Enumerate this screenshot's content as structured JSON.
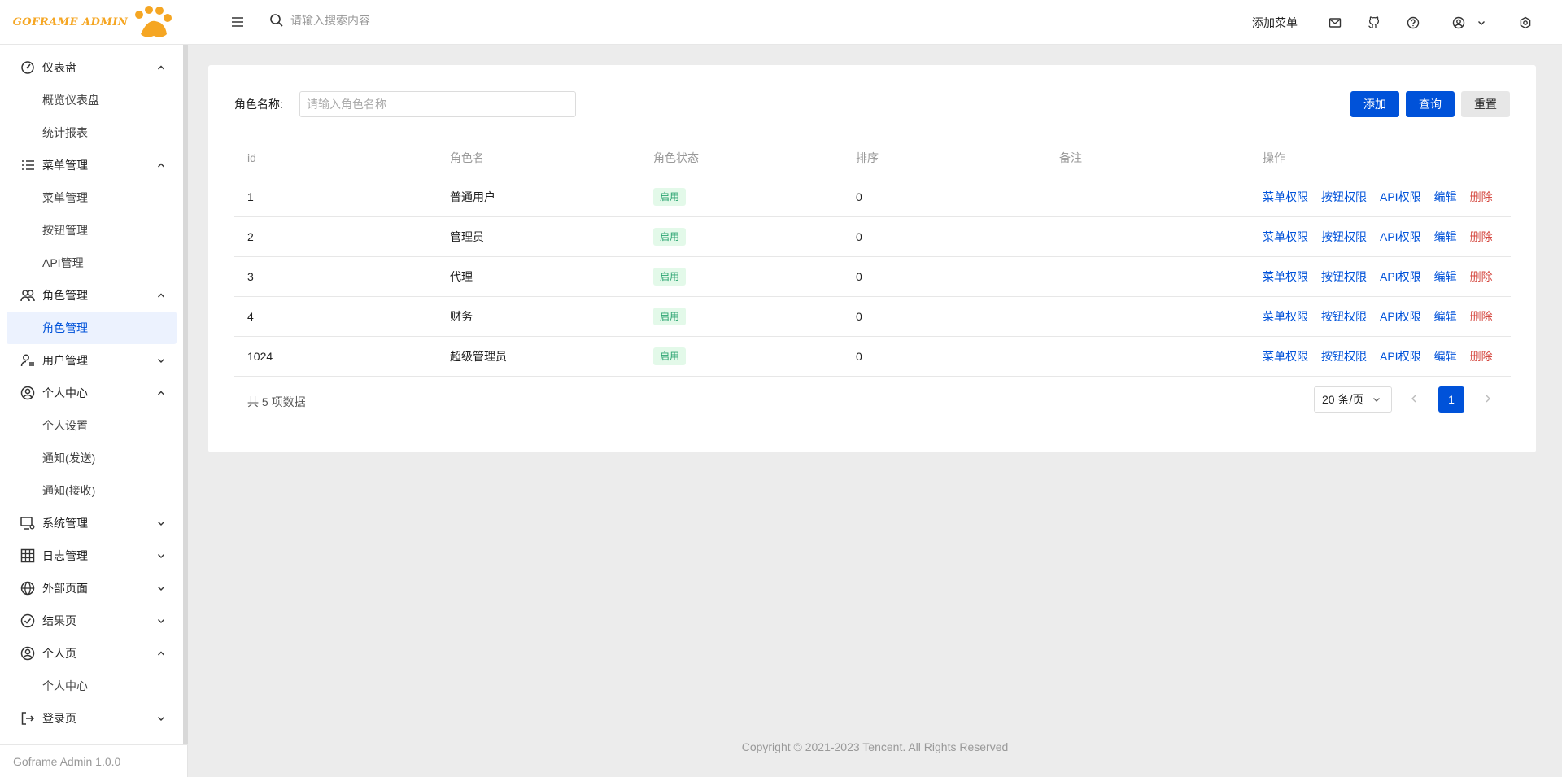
{
  "header": {
    "logo_text": "GOFRAME ADMIN",
    "search_placeholder": "请输入搜索内容",
    "add_menu_label": "添加菜单",
    "icons": [
      "menu-fold-icon",
      "search-icon",
      "mail-icon",
      "github-icon",
      "help-circle-icon",
      "user-circle-icon",
      "chevron-down-icon",
      "setting-icon"
    ]
  },
  "sidebar": {
    "groups": [
      {
        "label": "仪表盘",
        "icon": "dashboard-icon",
        "expanded": true,
        "items": [
          "概览仪表盘",
          "统计报表"
        ]
      },
      {
        "label": "菜单管理",
        "icon": "list-icon",
        "expanded": true,
        "items": [
          "菜单管理",
          "按钮管理",
          "API管理"
        ]
      },
      {
        "label": "角色管理",
        "icon": "usergroup-icon",
        "expanded": true,
        "items": [
          "角色管理"
        ]
      },
      {
        "label": "用户管理",
        "icon": "user-setting-icon",
        "expanded": false,
        "items": []
      },
      {
        "label": "个人中心",
        "icon": "user-circle-icon",
        "expanded": true,
        "items": [
          "个人设置",
          "通知(发送)",
          "通知(接收)"
        ]
      },
      {
        "label": "系统管理",
        "icon": "system-icon",
        "expanded": false,
        "items": []
      },
      {
        "label": "日志管理",
        "icon": "table-icon",
        "expanded": false,
        "items": []
      },
      {
        "label": "外部页面",
        "icon": "internet-icon",
        "expanded": false,
        "items": []
      },
      {
        "label": "结果页",
        "icon": "check-circle-icon",
        "expanded": false,
        "items": []
      },
      {
        "label": "个人页",
        "icon": "user-circle-icon",
        "expanded": true,
        "items": [
          "个人中心"
        ]
      },
      {
        "label": "登录页",
        "icon": "logout-icon",
        "expanded": false,
        "items": []
      }
    ],
    "active_item": "角色管理",
    "footer": "Goframe Admin 1.0.0"
  },
  "filter": {
    "label": "角色名称:",
    "placeholder": "请输入角色名称",
    "add_label": "添加",
    "query_label": "查询",
    "reset_label": "重置"
  },
  "table": {
    "columns": [
      "id",
      "角色名",
      "角色状态",
      "排序",
      "备注",
      "操作"
    ],
    "rows": [
      {
        "id": "1",
        "name": "普通用户",
        "status": "启用",
        "sort": "0",
        "remark": ""
      },
      {
        "id": "2",
        "name": "管理员",
        "status": "启用",
        "sort": "0",
        "remark": ""
      },
      {
        "id": "3",
        "name": "代理",
        "status": "启用",
        "sort": "0",
        "remark": ""
      },
      {
        "id": "4",
        "name": "财务",
        "status": "启用",
        "sort": "0",
        "remark": ""
      },
      {
        "id": "1024",
        "name": "超级管理员",
        "status": "启用",
        "sort": "0",
        "remark": ""
      }
    ],
    "actions": [
      "菜单权限",
      "按钮权限",
      "API权限",
      "编辑",
      "删除"
    ]
  },
  "pagination": {
    "total_text": "共 5 项数据",
    "page_size": "20 条/页",
    "current_page": "1"
  },
  "footer": {
    "copyright": "Copyright © 2021-2023 Tencent. All Rights Reserved"
  },
  "colors": {
    "primary": "#0052d9",
    "danger": "#d54941",
    "success_bg": "#e3f9e9",
    "success_text": "#2ba471",
    "logo": "#f5a623"
  }
}
